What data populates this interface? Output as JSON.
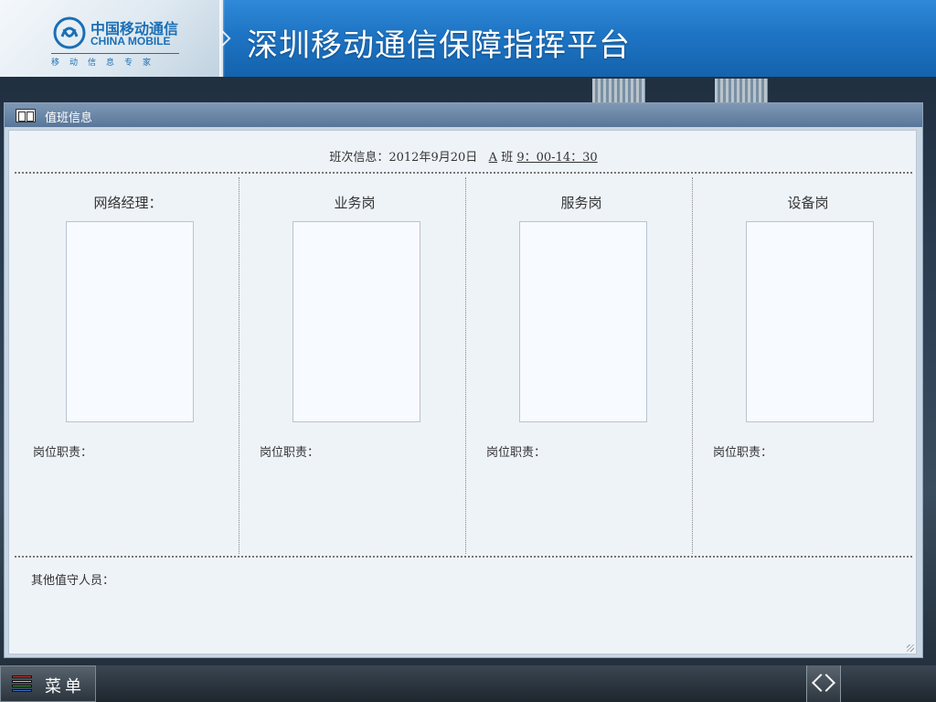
{
  "header": {
    "logo_cn": "中国移动通信",
    "logo_en": "CHINA MOBILE",
    "logo_slogan": "移动信息专家",
    "title": "深圳移动通信保障指挥平台"
  },
  "panel": {
    "title": "值班信息",
    "shift": {
      "label": "班次信息：",
      "date": "2012年9月20日",
      "shift_code": "A",
      "shift_word": "班",
      "time": "9：00-14：30"
    },
    "positions": [
      {
        "title": "网络经理：",
        "duty_label": "岗位职责："
      },
      {
        "title": "业务岗",
        "duty_label": "岗位职责："
      },
      {
        "title": "服务岗",
        "duty_label": "岗位职责："
      },
      {
        "title": "设备岗",
        "duty_label": "岗位职责："
      }
    ],
    "others_label": "其他值守人员："
  },
  "bottombar": {
    "menu_label": "菜单",
    "menu_icon_colors": [
      "#d33a3a",
      "#e8c531",
      "#3a9a3a",
      "#3c6fd1"
    ]
  },
  "colors": {
    "header_blue": "#1e74c4",
    "panel_title_blue": "#58769a",
    "logo_blue": "#1b6fb5"
  }
}
